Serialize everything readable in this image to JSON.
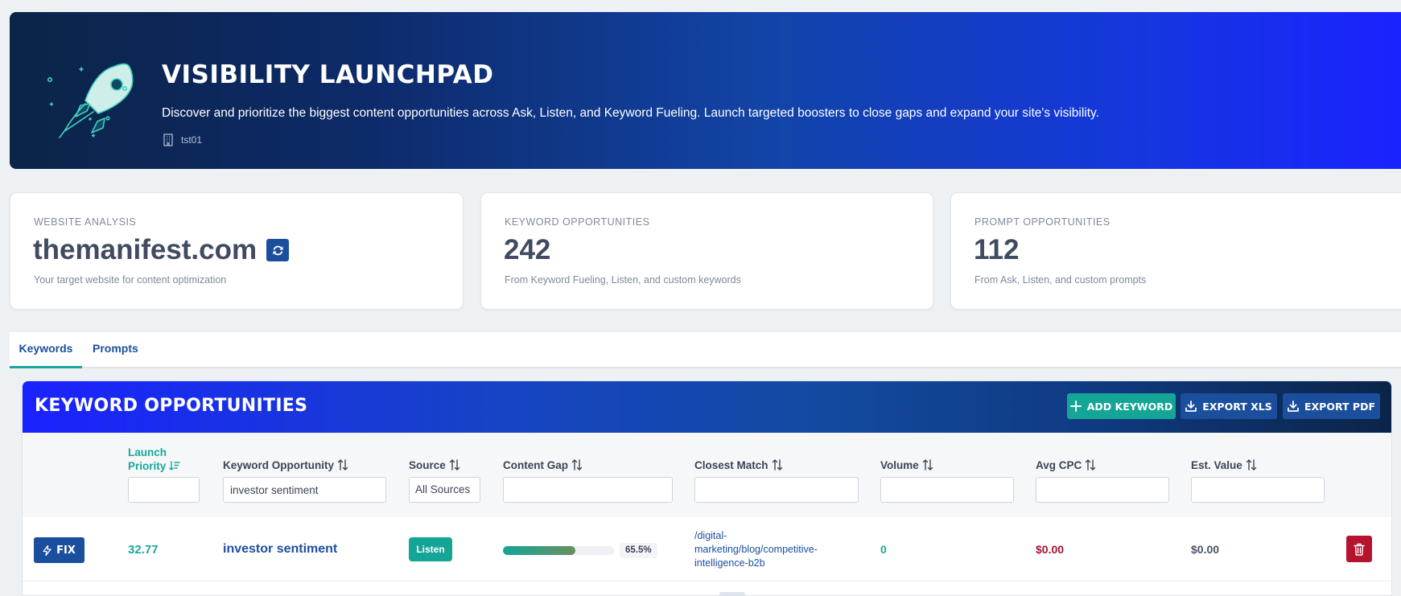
{
  "hero": {
    "title": "VISIBILITY LAUNCHPAD",
    "description": "Discover and prioritize the biggest content opportunities across Ask, Listen, and Keyword Fueling. Launch targeted boosters to close gaps and expand your site's visibility.",
    "org": "tst01",
    "icon": "rocket-icon"
  },
  "stats": {
    "website": {
      "label": "WEBSITE ANALYSIS",
      "value": "themanifest.com",
      "description": "Your target website for content optimization"
    },
    "keywords": {
      "label": "KEYWORD OPPORTUNITIES",
      "value": "242",
      "description": "From Keyword Fueling, Listen, and custom keywords"
    },
    "prompts": {
      "label": "PROMPT OPPORTUNITIES",
      "value": "112",
      "description": "From Ask, Listen, and custom prompts"
    }
  },
  "tabs": [
    {
      "label": "Keywords",
      "active": true
    },
    {
      "label": "Prompts",
      "active": false
    }
  ],
  "panel": {
    "title": "KEYWORD OPPORTUNITIES",
    "buttons": {
      "add": "ADD KEYWORD",
      "export_xls": "EXPORT XLS",
      "export_pdf": "EXPORT PDF"
    }
  },
  "columns": {
    "priority_line1": "Launch",
    "priority_line2": "Priority",
    "keyword": "Keyword Opportunity",
    "source": "Source",
    "gap": "Content Gap",
    "closest": "Closest Match",
    "volume": "Volume",
    "cpc": "Avg CPC",
    "value": "Est. Value"
  },
  "filters": {
    "priority": "",
    "keyword": "investor sentiment",
    "source": "All Sources",
    "gap": "",
    "closest": "",
    "volume": "",
    "cpc": "",
    "value": ""
  },
  "rows": [
    {
      "action": "FIX",
      "priority": "32.77",
      "keyword": "investor sentiment",
      "source": "Listen",
      "gap_percent": 65.5,
      "gap_label": "65.5%",
      "closest": "/digital-marketing/blog/competitive-intelligence-b2b",
      "volume": "0",
      "cpc": "$0.00",
      "value": "$0.00"
    }
  ],
  "colors": {
    "teal": "#14a596",
    "navy": "#1b4f9e",
    "danger": "#b5132e"
  }
}
